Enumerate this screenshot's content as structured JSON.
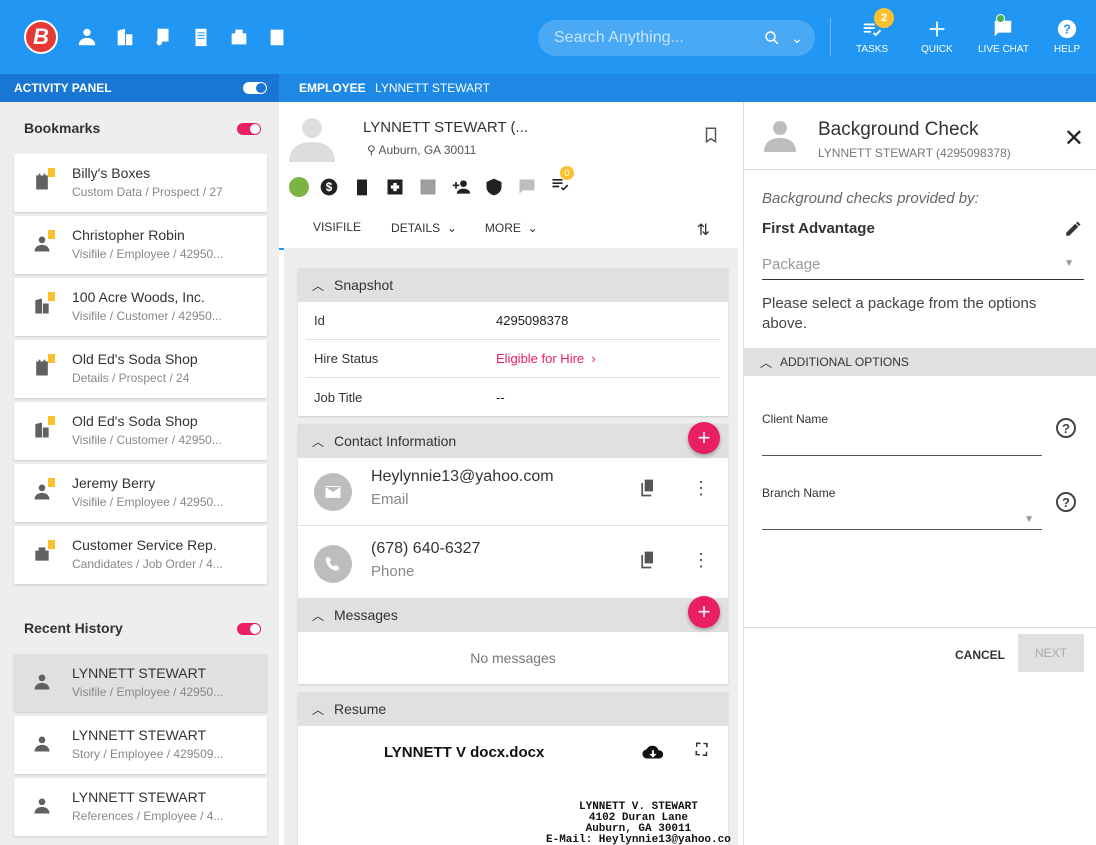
{
  "topbar": {
    "logo": "B",
    "search_placeholder": "Search Anything...",
    "tasks_label": "TASKS",
    "tasks_badge": "2",
    "quick_label": "QUICK",
    "livechat_label": "LIVE CHAT",
    "help_label": "HELP"
  },
  "subbar": {
    "activity_panel": "ACTIVITY PANEL",
    "employee_prefix": "EMPLOYEE",
    "employee_name": "LYNNETT STEWART"
  },
  "bookmarks": {
    "title": "Bookmarks",
    "items": [
      {
        "title": "Billy's Boxes",
        "sub": "Custom Data / Prospect / 27",
        "icon": "prospect-icon"
      },
      {
        "title": "Christopher Robin",
        "sub": "Visifile / Employee / 42950...",
        "icon": "employee-icon"
      },
      {
        "title": "100 Acre Woods, Inc.",
        "sub": "Visifile / Customer / 42950...",
        "icon": "customer-icon"
      },
      {
        "title": "Old Ed's Soda Shop",
        "sub": "Details / Prospect / 24",
        "icon": "prospect-icon"
      },
      {
        "title": "Old Ed's Soda Shop",
        "sub": "Visifile / Customer / 42950...",
        "icon": "customer-icon"
      },
      {
        "title": "Jeremy Berry",
        "sub": "Visifile / Employee / 42950...",
        "icon": "employee-icon"
      },
      {
        "title": "Customer Service Rep.",
        "sub": "Candidates / Job Order / 4...",
        "icon": "job-order-icon"
      }
    ]
  },
  "recent": {
    "title": "Recent History",
    "items": [
      {
        "title": "LYNNETT STEWART",
        "sub": "Visifile / Employee / 42950..."
      },
      {
        "title": "LYNNETT STEWART",
        "sub": "Story / Employee / 429509..."
      },
      {
        "title": "LYNNETT STEWART",
        "sub": "References / Employee / 4..."
      }
    ]
  },
  "profile": {
    "name": "LYNNETT STEWART (...",
    "location": "Auburn, GA 30011",
    "alert_badge": "0",
    "tabs": [
      "VISIFILE",
      "DETAILS",
      "MORE"
    ]
  },
  "snapshot": {
    "title": "Snapshot",
    "rows": [
      {
        "k": "Id",
        "v": "4295098378"
      },
      {
        "k": "Hire Status",
        "v": "Eligible for Hire"
      },
      {
        "k": "Job Title",
        "v": "--"
      }
    ]
  },
  "contact": {
    "title": "Contact Information",
    "rows": [
      {
        "value": "Heylynnie13@yahoo.com",
        "type": "Email"
      },
      {
        "value": "(678) 640-6327",
        "type": "Phone"
      }
    ]
  },
  "messages": {
    "title": "Messages",
    "empty": "No messages"
  },
  "resume": {
    "title": "Resume",
    "filename": "LYNNETT V docx.docx",
    "text": "LYNNETT V. STEWART\n4102 Duran Lane\nAuburn, GA 30011\nE-Mail: Heylynnie13@yahoo.co"
  },
  "bgcheck": {
    "title": "Background Check",
    "subtitle": "LYNNETT STEWART (4295098378)",
    "provided_by": "Background checks provided by:",
    "provider": "First Advantage",
    "package_placeholder": "Package",
    "package_msg": "Please select a package from the options above.",
    "additional": "ADDITIONAL OPTIONS",
    "client_name": "Client Name",
    "branch_name": "Branch Name",
    "cancel": "CANCEL",
    "next": "NEXT"
  },
  "colors": {
    "primary": "#2196f3",
    "accent": "#e91e63",
    "badge": "#fbc02d",
    "status_green": "#7cb342"
  }
}
